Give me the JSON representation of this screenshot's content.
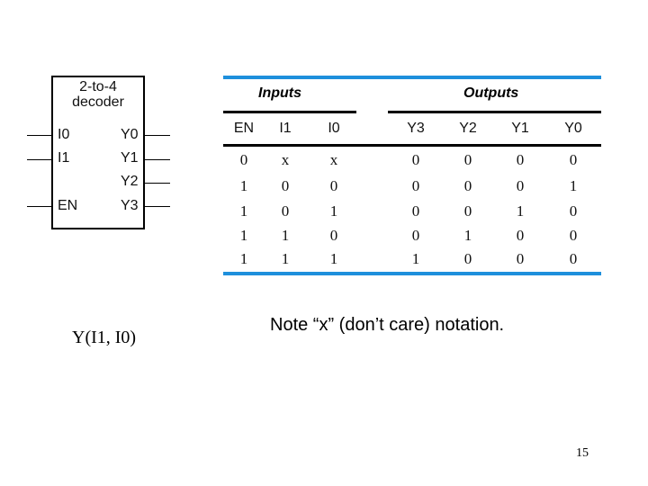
{
  "decoder": {
    "title_line1": "2-to-4",
    "title_line2": "decoder",
    "inputs": [
      "I0",
      "I1",
      "EN"
    ],
    "outputs": [
      "Y0",
      "Y1",
      "Y2",
      "Y3"
    ]
  },
  "truth_table": {
    "group_headers": {
      "inputs": "Inputs",
      "outputs": "Outputs"
    },
    "columns": [
      "EN",
      "I1",
      "I0",
      "Y3",
      "Y2",
      "Y1",
      "Y0"
    ],
    "rows": [
      [
        "0",
        "x",
        "x",
        "0",
        "0",
        "0",
        "0"
      ],
      [
        "1",
        "0",
        "0",
        "0",
        "0",
        "0",
        "1"
      ],
      [
        "1",
        "0",
        "1",
        "0",
        "0",
        "1",
        "0"
      ],
      [
        "1",
        "1",
        "0",
        "0",
        "1",
        "0",
        "0"
      ],
      [
        "1",
        "1",
        "1",
        "1",
        "0",
        "0",
        "0"
      ]
    ]
  },
  "captions": {
    "left": "Y(I1, I0)",
    "right": "Note “x” (don’t care) notation."
  },
  "page_number": "15",
  "colors": {
    "accent_bar": "#1e8fdc"
  }
}
